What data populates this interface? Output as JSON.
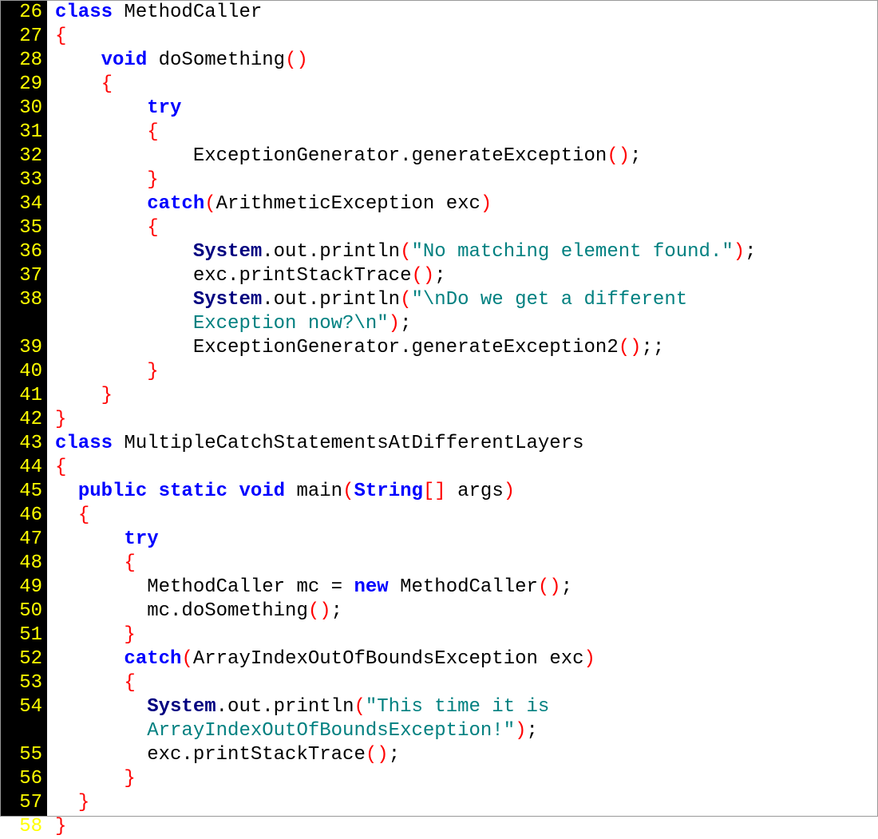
{
  "startLine": 26,
  "lines": [
    {
      "n": 26,
      "tokens": [
        {
          "t": "class ",
          "c": "kw bold"
        },
        {
          "t": "MethodCaller",
          "c": "id"
        }
      ]
    },
    {
      "n": 27,
      "tokens": [
        {
          "t": "{",
          "c": "brace"
        }
      ]
    },
    {
      "n": 28,
      "tokens": [
        {
          "t": "    ",
          "c": ""
        },
        {
          "t": "void ",
          "c": "kw bold"
        },
        {
          "t": "doSomething",
          "c": "id"
        },
        {
          "t": "()",
          "c": "paren"
        }
      ]
    },
    {
      "n": 29,
      "tokens": [
        {
          "t": "    ",
          "c": ""
        },
        {
          "t": "{",
          "c": "brace"
        }
      ]
    },
    {
      "n": 30,
      "tokens": [
        {
          "t": "        ",
          "c": ""
        },
        {
          "t": "try",
          "c": "kw bold"
        }
      ]
    },
    {
      "n": 31,
      "tokens": [
        {
          "t": "        ",
          "c": ""
        },
        {
          "t": "{",
          "c": "brace"
        }
      ]
    },
    {
      "n": 32,
      "tokens": [
        {
          "t": "            ExceptionGenerator.generateException",
          "c": "id"
        },
        {
          "t": "()",
          "c": "paren"
        },
        {
          "t": ";",
          "c": "id"
        }
      ]
    },
    {
      "n": 33,
      "tokens": [
        {
          "t": "        ",
          "c": ""
        },
        {
          "t": "}",
          "c": "brace"
        }
      ]
    },
    {
      "n": 34,
      "tokens": [
        {
          "t": "        ",
          "c": ""
        },
        {
          "t": "catch",
          "c": "kw bold"
        },
        {
          "t": "(",
          "c": "paren"
        },
        {
          "t": "ArithmeticException exc",
          "c": "id"
        },
        {
          "t": ")",
          "c": "paren"
        }
      ]
    },
    {
      "n": 35,
      "tokens": [
        {
          "t": "        ",
          "c": ""
        },
        {
          "t": "{",
          "c": "brace"
        }
      ]
    },
    {
      "n": 36,
      "tokens": [
        {
          "t": "            ",
          "c": ""
        },
        {
          "t": "System",
          "c": "sys"
        },
        {
          "t": ".out.println",
          "c": "id"
        },
        {
          "t": "(",
          "c": "paren"
        },
        {
          "t": "\"No matching element found.\"",
          "c": "str"
        },
        {
          "t": ")",
          "c": "paren"
        },
        {
          "t": ";",
          "c": "id"
        }
      ]
    },
    {
      "n": 37,
      "tokens": [
        {
          "t": "            exc.printStackTrace",
          "c": "id"
        },
        {
          "t": "()",
          "c": "paren"
        },
        {
          "t": ";",
          "c": "id"
        }
      ]
    },
    {
      "n": 38,
      "tokens": [
        {
          "t": "            ",
          "c": ""
        },
        {
          "t": "System",
          "c": "sys"
        },
        {
          "t": ".out.println",
          "c": "id"
        },
        {
          "t": "(",
          "c": "paren"
        },
        {
          "t": "\"\\nDo we get a different ",
          "c": "str"
        }
      ]
    },
    {
      "n": "",
      "tokens": [
        {
          "t": "            ",
          "c": ""
        },
        {
          "t": "Exception now?\\n\"",
          "c": "str"
        },
        {
          "t": ")",
          "c": "paren"
        },
        {
          "t": ";",
          "c": "id"
        }
      ]
    },
    {
      "n": 39,
      "tokens": [
        {
          "t": "            ExceptionGenerator.generateException2",
          "c": "id"
        },
        {
          "t": "()",
          "c": "paren"
        },
        {
          "t": ";;",
          "c": "id"
        }
      ]
    },
    {
      "n": 40,
      "tokens": [
        {
          "t": "        ",
          "c": ""
        },
        {
          "t": "}",
          "c": "brace"
        }
      ]
    },
    {
      "n": 41,
      "tokens": [
        {
          "t": "    ",
          "c": ""
        },
        {
          "t": "}",
          "c": "brace"
        }
      ]
    },
    {
      "n": 42,
      "tokens": [
        {
          "t": "}",
          "c": "brace"
        }
      ]
    },
    {
      "n": 43,
      "tokens": [
        {
          "t": "class ",
          "c": "kw bold"
        },
        {
          "t": "MultipleCatchStatementsAtDifferentLayers",
          "c": "id"
        }
      ]
    },
    {
      "n": 44,
      "tokens": [
        {
          "t": "{",
          "c": "brace"
        }
      ]
    },
    {
      "n": 45,
      "tokens": [
        {
          "t": "  ",
          "c": ""
        },
        {
          "t": "public static void ",
          "c": "kw bold"
        },
        {
          "t": "main",
          "c": "id"
        },
        {
          "t": "(",
          "c": "paren"
        },
        {
          "t": "String",
          "c": "kw bold"
        },
        {
          "t": "[]",
          "c": "bracket"
        },
        {
          "t": " args",
          "c": "id"
        },
        {
          "t": ")",
          "c": "paren"
        }
      ]
    },
    {
      "n": 46,
      "tokens": [
        {
          "t": "  ",
          "c": ""
        },
        {
          "t": "{",
          "c": "brace"
        }
      ]
    },
    {
      "n": 47,
      "tokens": [
        {
          "t": "      ",
          "c": ""
        },
        {
          "t": "try",
          "c": "kw bold"
        }
      ]
    },
    {
      "n": 48,
      "tokens": [
        {
          "t": "      ",
          "c": ""
        },
        {
          "t": "{",
          "c": "brace"
        }
      ]
    },
    {
      "n": 49,
      "tokens": [
        {
          "t": "        MethodCaller mc = ",
          "c": "id"
        },
        {
          "t": "new ",
          "c": "kw bold"
        },
        {
          "t": "MethodCaller",
          "c": "id"
        },
        {
          "t": "()",
          "c": "paren"
        },
        {
          "t": ";",
          "c": "id"
        }
      ]
    },
    {
      "n": 50,
      "tokens": [
        {
          "t": "        mc.doSomething",
          "c": "id"
        },
        {
          "t": "()",
          "c": "paren"
        },
        {
          "t": ";",
          "c": "id"
        }
      ]
    },
    {
      "n": 51,
      "tokens": [
        {
          "t": "      ",
          "c": ""
        },
        {
          "t": "}",
          "c": "brace"
        }
      ]
    },
    {
      "n": 52,
      "tokens": [
        {
          "t": "      ",
          "c": ""
        },
        {
          "t": "catch",
          "c": "kw bold"
        },
        {
          "t": "(",
          "c": "paren"
        },
        {
          "t": "ArrayIndexOutOfBoundsException exc",
          "c": "id"
        },
        {
          "t": ")",
          "c": "paren"
        }
      ]
    },
    {
      "n": 53,
      "tokens": [
        {
          "t": "      ",
          "c": ""
        },
        {
          "t": "{",
          "c": "brace"
        }
      ]
    },
    {
      "n": 54,
      "tokens": [
        {
          "t": "        ",
          "c": ""
        },
        {
          "t": "System",
          "c": "sys"
        },
        {
          "t": ".out.println",
          "c": "id"
        },
        {
          "t": "(",
          "c": "paren"
        },
        {
          "t": "\"This time it is ",
          "c": "str"
        }
      ]
    },
    {
      "n": "",
      "tokens": [
        {
          "t": "        ",
          "c": ""
        },
        {
          "t": "ArrayIndexOutOfBoundsException!\"",
          "c": "str"
        },
        {
          "t": ")",
          "c": "paren"
        },
        {
          "t": ";",
          "c": "id"
        }
      ]
    },
    {
      "n": 55,
      "tokens": [
        {
          "t": "        exc.printStackTrace",
          "c": "id"
        },
        {
          "t": "()",
          "c": "paren"
        },
        {
          "t": ";",
          "c": "id"
        }
      ]
    },
    {
      "n": 56,
      "tokens": [
        {
          "t": "      ",
          "c": ""
        },
        {
          "t": "}",
          "c": "brace"
        }
      ]
    },
    {
      "n": 57,
      "tokens": [
        {
          "t": "  ",
          "c": ""
        },
        {
          "t": "}",
          "c": "brace"
        }
      ]
    },
    {
      "n": 58,
      "tokens": [
        {
          "t": "}",
          "c": "brace"
        }
      ]
    }
  ]
}
